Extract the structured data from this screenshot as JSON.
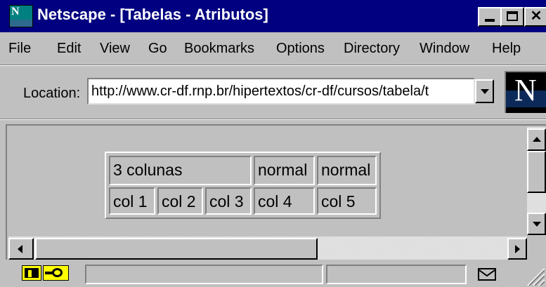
{
  "window": {
    "title": "Netscape - [Tabelas - Atributos]",
    "title_bar_color": "#000080",
    "controls": {
      "minimize_icon": "minimize-icon",
      "maximize_icon": "maximize-icon",
      "close_icon": "close-icon",
      "close_glyph": "✕"
    }
  },
  "app_icon": {
    "name": "netscape-icon",
    "letter": "N"
  },
  "menu": {
    "items": [
      {
        "label": "File"
      },
      {
        "label": "Edit"
      },
      {
        "label": "View"
      },
      {
        "label": "Go"
      },
      {
        "label": "Bookmarks"
      },
      {
        "label": "Options"
      },
      {
        "label": "Directory"
      },
      {
        "label": "Window"
      },
      {
        "label": "Help"
      }
    ]
  },
  "location": {
    "label": "Location:",
    "value": "http://www.cr-df.rnp.br/hipertextos/cr-df/cursos/tabela/t"
  },
  "throbber": {
    "letter": "N",
    "icon": "netscape-logo-icon"
  },
  "table": {
    "rows": [
      [
        "3 colunas",
        "normal",
        "normal"
      ],
      [
        "col 1",
        "col 2",
        "col 3",
        "col 4",
        "col 5"
      ]
    ]
  },
  "status": {
    "text": "",
    "icons": [
      "security-key-icon",
      "connection-status-icon",
      "mail-icon"
    ]
  },
  "colors": {
    "chrome": "#c0c0c0",
    "title_bar": "#000080",
    "title_text": "#ffffff",
    "input_bg": "#ffffff",
    "status_icon_bg": "#ffff00"
  }
}
